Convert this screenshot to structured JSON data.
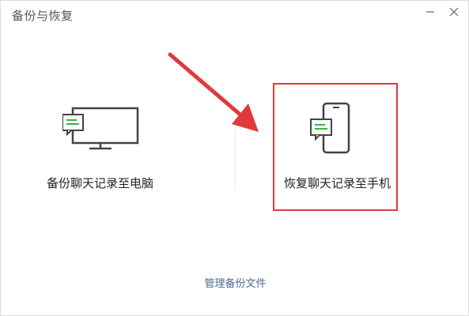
{
  "window": {
    "title": "备份与恢复"
  },
  "options": {
    "backup_label": "备份聊天记录至电脑",
    "restore_label": "恢复聊天记录至手机"
  },
  "footer": {
    "manage_label": "管理备份文件"
  },
  "colors": {
    "accent_green": "#3bb44a",
    "highlight_red": "#e03a3a",
    "link_blue": "#4a6a90",
    "icon_gray": "#555555"
  },
  "icons": [
    "minimize-icon",
    "close-icon",
    "monitor-icon",
    "phone-icon",
    "chat-bubble-icon",
    "arrow-annotation"
  ]
}
